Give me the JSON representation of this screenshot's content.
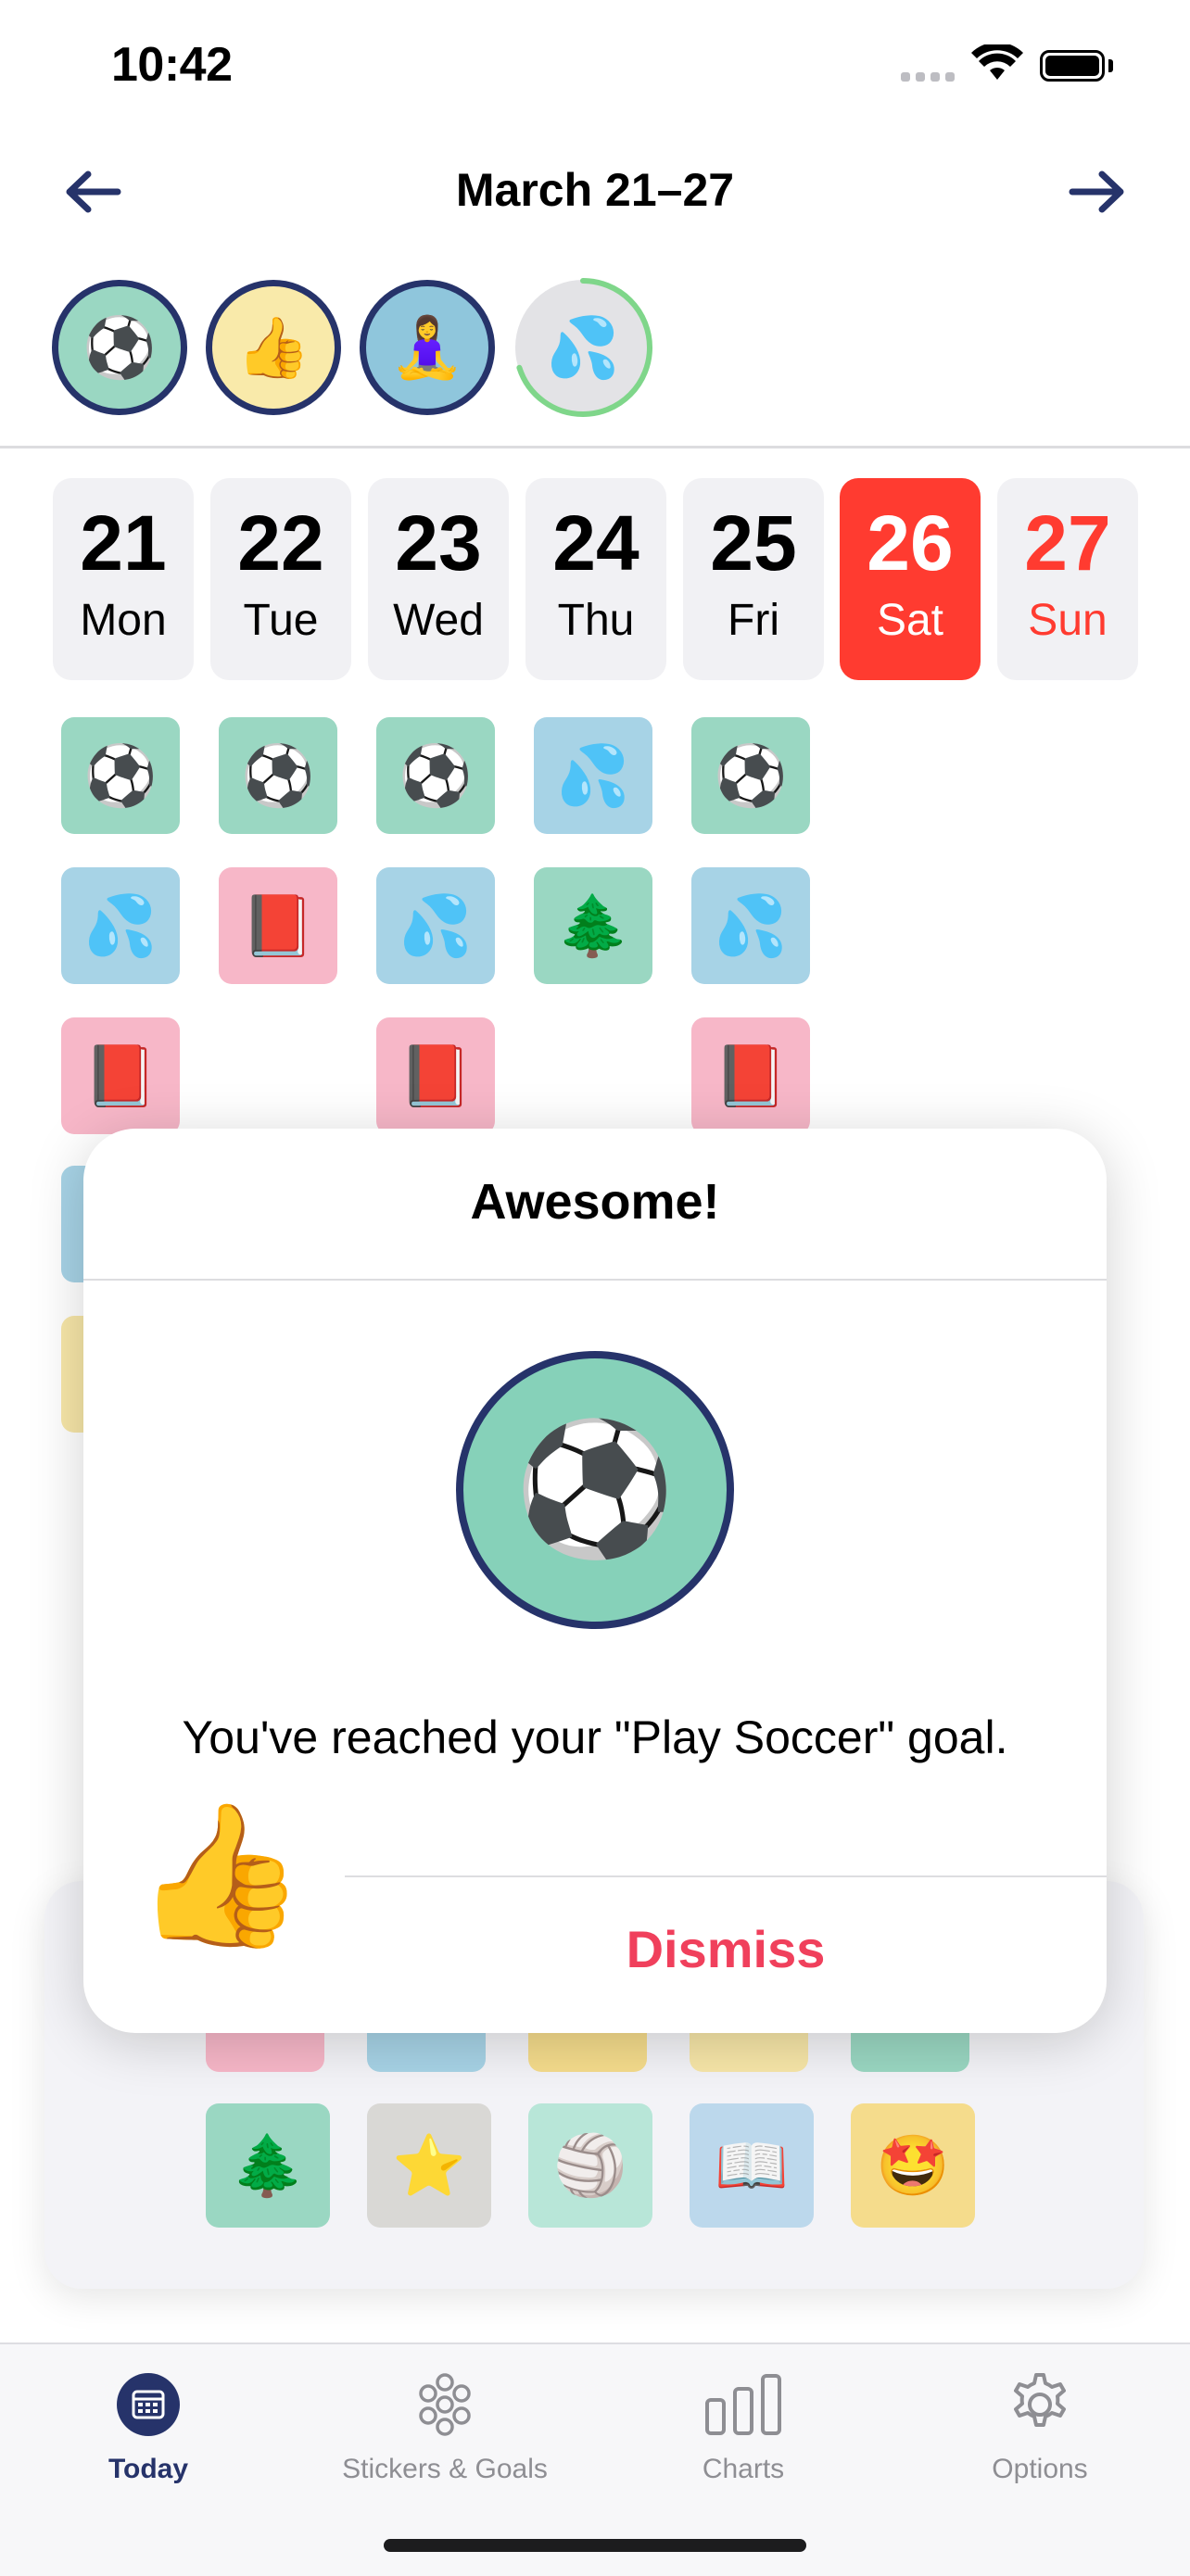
{
  "status": {
    "time": "10:42"
  },
  "header": {
    "title": "March 21–27",
    "prev_icon": "arrow-left-icon",
    "next_icon": "arrow-right-icon"
  },
  "goals": [
    {
      "emoji": "⚽",
      "name": "soccer",
      "color": "#9ad7c2"
    },
    {
      "emoji": "👍",
      "name": "thumbs-up",
      "color": "#f9eaaa"
    },
    {
      "emoji": "🧘‍♀️",
      "name": "yoga",
      "color": "#8fc6dc"
    },
    {
      "emoji": "💦",
      "name": "sweat",
      "color": "#e3e3e6",
      "progress": 0.7
    }
  ],
  "days": [
    {
      "num": "21",
      "weekday": "Mon"
    },
    {
      "num": "22",
      "weekday": "Tue"
    },
    {
      "num": "23",
      "weekday": "Wed"
    },
    {
      "num": "24",
      "weekday": "Thu"
    },
    {
      "num": "25",
      "weekday": "Fri"
    },
    {
      "num": "26",
      "weekday": "Sat"
    },
    {
      "num": "27",
      "weekday": "Sun"
    }
  ],
  "stickers": {
    "row1": [
      "⚽",
      "⚽",
      "⚽",
      "💦",
      "⚽"
    ],
    "row2": [
      "💦",
      "📕",
      "💦",
      "🌲",
      "💦"
    ],
    "row3": [
      "📕",
      "📕",
      "📕"
    ],
    "picker": [
      "🌲",
      "⭐",
      "🏐",
      "📖",
      "🤩"
    ]
  },
  "alert": {
    "title": "Awesome!",
    "goal_emoji": "⚽",
    "message": "You've reached your \"Play Soccer\" goal.",
    "dismiss": "Dismiss",
    "mascot": "👍"
  },
  "tabs": [
    {
      "label": "Today",
      "icon": "calendar-icon",
      "active": true
    },
    {
      "label": "Stickers & Goals",
      "icon": "flower-grid-icon"
    },
    {
      "label": "Charts",
      "icon": "bar-chart-icon"
    },
    {
      "label": "Options",
      "icon": "gear-icon"
    }
  ],
  "colors": {
    "accent": "#26336a",
    "today": "#ff3b30",
    "dismiss": "#f0405c"
  }
}
